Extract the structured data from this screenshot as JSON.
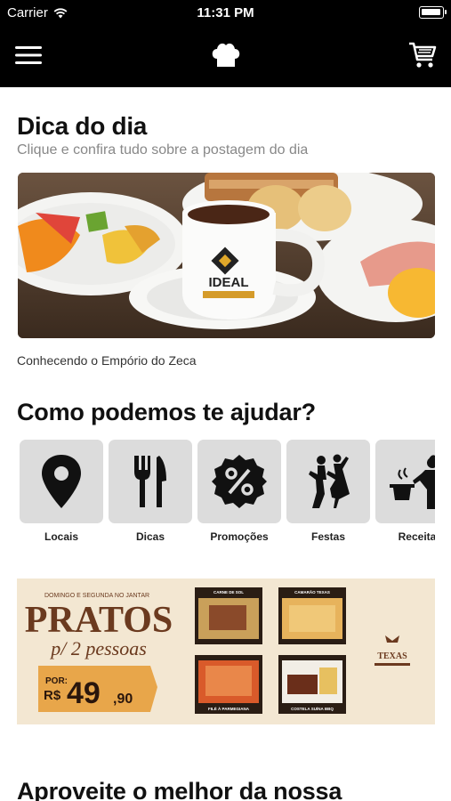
{
  "status_bar": {
    "carrier": "Carrier",
    "time": "11:31 PM"
  },
  "colors": {
    "nav_bg": "#000000",
    "tile_bg": "#dcdcdc",
    "banner_bg": "#f3e7d2",
    "banner_text": "#6b3a1f",
    "price_tag": "#e8a64a"
  },
  "tip": {
    "title": "Dica do dia",
    "subtitle": "Clique e confira tudo sobre a postagem do dia",
    "image_text": "IDEAL",
    "caption": "Conhecendo o Empório do Zeca"
  },
  "help": {
    "title": "Como podemos te ajudar?",
    "items": [
      {
        "label": "Locais",
        "icon": "location-pin-icon"
      },
      {
        "label": "Dicas",
        "icon": "fork-knife-icon"
      },
      {
        "label": "Promoções",
        "icon": "percent-badge-icon"
      },
      {
        "label": "Festas",
        "icon": "dancing-couple-icon"
      },
      {
        "label": "Receita",
        "icon": "chef-cooking-icon"
      }
    ]
  },
  "promo": {
    "top_line": "DOMINGO E SEGUNDA NO JANTAR",
    "headline": "PRATOS",
    "subline": "p/ 2 pessoas",
    "price_prefix": "POR:",
    "price_currency": "R$",
    "price_int": "49",
    "price_cents": ",90",
    "dishes": [
      "CARNE DE SOL",
      "CAMARÃO TEXAS",
      "FILÉ À PARMEGIANA",
      "COSTELA SUÍNA BBQ"
    ],
    "brand": "TEXAS"
  },
  "more": {
    "title": "Aproveite o melhor da nossa"
  }
}
